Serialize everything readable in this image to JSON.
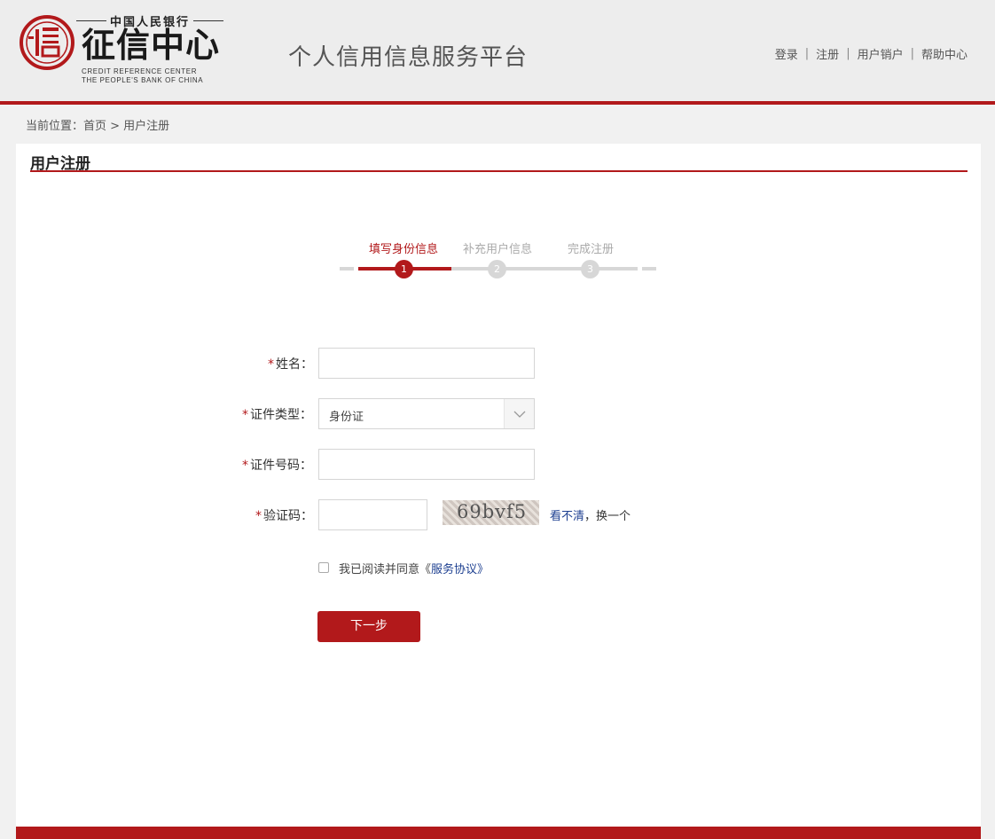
{
  "header": {
    "logo_top": "中国人民银行",
    "logo_main": "征信中心",
    "logo_en_line1": "CREDIT REFERENCE CENTER",
    "logo_en_line2": "THE PEOPLE'S BANK OF CHINA",
    "platform_title": "个人信用信息服务平台",
    "nav": {
      "login": "登录",
      "register": "注册",
      "cancel_account": "用户销户",
      "help": "帮助中心",
      "separator": "|"
    }
  },
  "breadcrumb": "当前位置：首页 > 用户注册",
  "panel": {
    "title": "用户注册"
  },
  "steps": [
    {
      "label": "填写身份信息",
      "number": "1",
      "active": true
    },
    {
      "label": "补充用户信息",
      "number": "2",
      "active": false
    },
    {
      "label": "完成注册",
      "number": "3",
      "active": false
    }
  ],
  "form": {
    "required_mark": "*",
    "name_label": "姓名：",
    "name_value": "",
    "id_type_label": "证件类型：",
    "id_type_value": "身份证",
    "id_number_label": "证件号码：",
    "id_number_value": "",
    "captcha_label": "验证码：",
    "captcha_value": "",
    "captcha_image_text": "69bvf5",
    "refresh_prefix": "看不清",
    "refresh_suffix": "，换一个",
    "agree_text": "我已阅读并同意《",
    "agree_link": "服务协议》",
    "next_button": "下一步"
  },
  "colors": {
    "brand_red": "#b2191b",
    "link_blue": "#1d3f90"
  }
}
